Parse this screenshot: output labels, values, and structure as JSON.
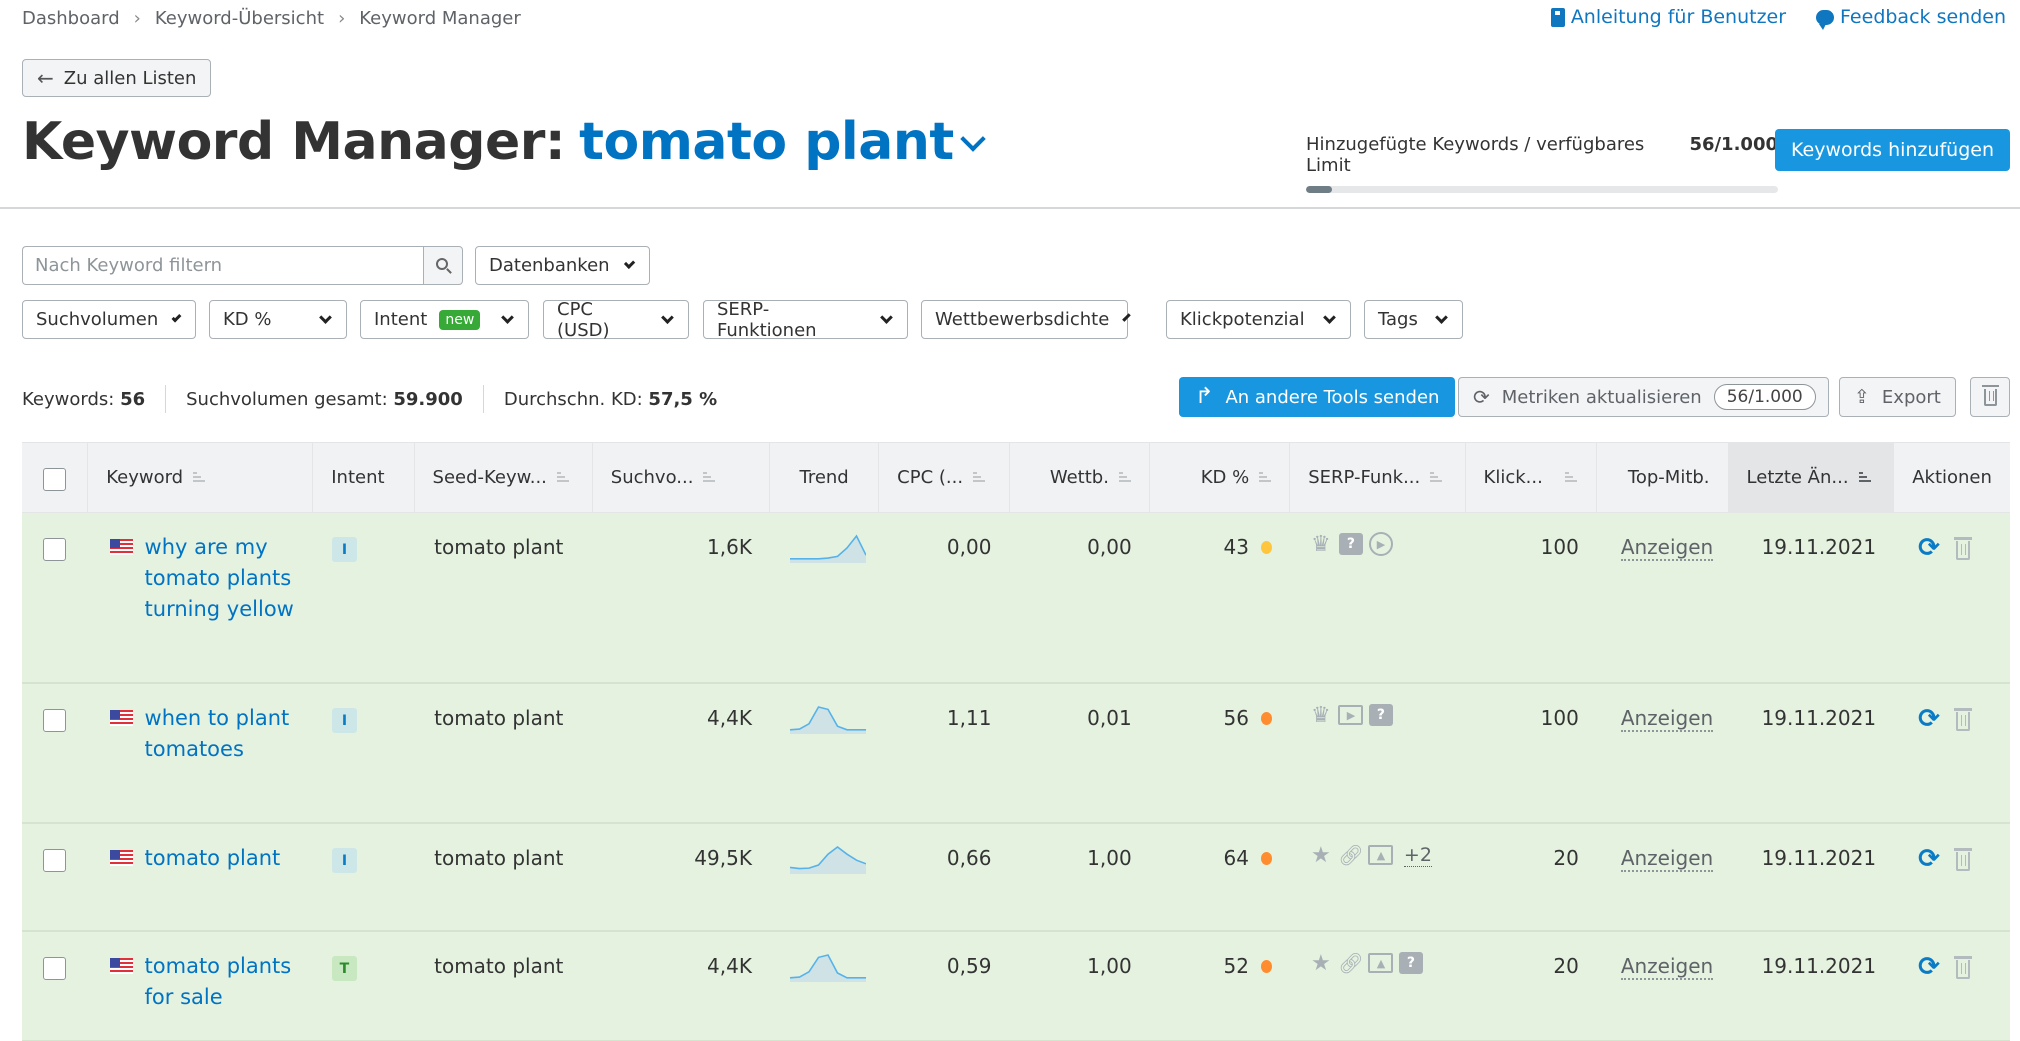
{
  "breadcrumb": [
    "Dashboard",
    "Keyword-Übersicht",
    "Keyword Manager"
  ],
  "top_links": {
    "guide": "Anleitung für Benutzer",
    "feedback": "Feedback senden"
  },
  "back_button": "Zu allen Listen",
  "title": {
    "prefix": "Keyword Manager:",
    "list_name": "tomato plant"
  },
  "limit": {
    "label": "Hinzugefügte Keywords / verfügbares Limit",
    "value": "56/1.000",
    "used": 56,
    "total": 1000
  },
  "add_button": "Keywords hinzufügen",
  "search": {
    "placeholder": "Nach Keyword filtern",
    "value": ""
  },
  "databases_dropdown": "Datenbanken",
  "filters": [
    {
      "label": "Suchvolumen"
    },
    {
      "label": "KD %"
    },
    {
      "label": "Intent",
      "badge": "new"
    },
    {
      "label": "CPC (USD)"
    },
    {
      "label": "SERP-Funktionen"
    },
    {
      "label": "Wettbewerbsdichte"
    },
    {
      "label": "Klickpotenzial"
    },
    {
      "label": "Tags"
    }
  ],
  "summary": {
    "keywords_label": "Keywords:",
    "keywords_value": "56",
    "volume_label": "Suchvolumen gesamt:",
    "volume_value": "59.900",
    "kd_label": "Durchschn. KD:",
    "kd_value": "57,5 %"
  },
  "actions": {
    "send": "An andere Tools senden",
    "update": "Metriken aktualisieren",
    "update_count": "56/1.000",
    "export": "Export"
  },
  "columns": [
    "Keyword",
    "Intent",
    "Seed-Keyw...",
    "Suchvo...",
    "Trend",
    "CPC (...",
    "Wettb.",
    "KD %",
    "SERP-Funk...",
    "Klick...",
    "Top-Mitb.",
    "Letzte Än...",
    "Aktionen"
  ],
  "colors": {
    "accent": "#0073c3",
    "primary_button": "#1897e0",
    "row_bg": "#e5f2e0",
    "kd_yellow": "#ffc53d",
    "kd_orange": "#ff8c2e"
  },
  "rows": [
    {
      "keyword": "why are my tomato plants turning yellow",
      "intent": "I",
      "seed": "tomato plant",
      "volume": "1,6K",
      "trend": [
        0.05,
        0.05,
        0.05,
        0.05,
        0.08,
        0.15,
        0.5,
        1.0,
        0.2
      ],
      "cpc": "0,00",
      "competition": "0,00",
      "kd": "43",
      "kd_color": "#ffc53d",
      "serp": [
        "crown-icon",
        "faq-icon",
        "video-icon"
      ],
      "serp_more": "",
      "clicks": "100",
      "top": "Anzeigen",
      "date": "19.11.2021"
    },
    {
      "keyword": "when to plant tomatoes",
      "intent": "I",
      "seed": "tomato plant",
      "volume": "4,4K",
      "trend": [
        0.05,
        0.08,
        0.3,
        1.0,
        0.9,
        0.2,
        0.05,
        0.05,
        0.05
      ],
      "cpc": "1,11",
      "competition": "0,01",
      "kd": "56",
      "kd_color": "#ff8c2e",
      "serp": [
        "crown-icon",
        "video-icon",
        "faq-icon"
      ],
      "serp_more": "",
      "clicks": "100",
      "top": "Anzeigen",
      "date": "19.11.2021"
    },
    {
      "keyword": "tomato plant",
      "intent": "I",
      "seed": "tomato plant",
      "volume": "49,5K",
      "trend": [
        0.15,
        0.1,
        0.12,
        0.25,
        0.7,
        1.0,
        0.7,
        0.45,
        0.3
      ],
      "cpc": "0,66",
      "competition": "1,00",
      "kd": "64",
      "kd_color": "#ff8c2e",
      "serp": [
        "star-icon",
        "link-icon",
        "image-icon"
      ],
      "serp_more": "+2",
      "clicks": "20",
      "top": "Anzeigen",
      "date": "19.11.2021"
    },
    {
      "keyword": "tomato plants for sale",
      "intent": "T",
      "seed": "tomato plant",
      "volume": "4,4K",
      "trend": [
        0.05,
        0.08,
        0.3,
        0.9,
        1.0,
        0.25,
        0.05,
        0.05,
        0.05
      ],
      "cpc": "0,59",
      "competition": "1,00",
      "kd": "52",
      "kd_color": "#ff8c2e",
      "serp": [
        "star-icon",
        "link-icon",
        "image-icon",
        "faq-icon"
      ],
      "serp_more": "",
      "clicks": "20",
      "top": "Anzeigen",
      "date": "19.11.2021"
    }
  ]
}
